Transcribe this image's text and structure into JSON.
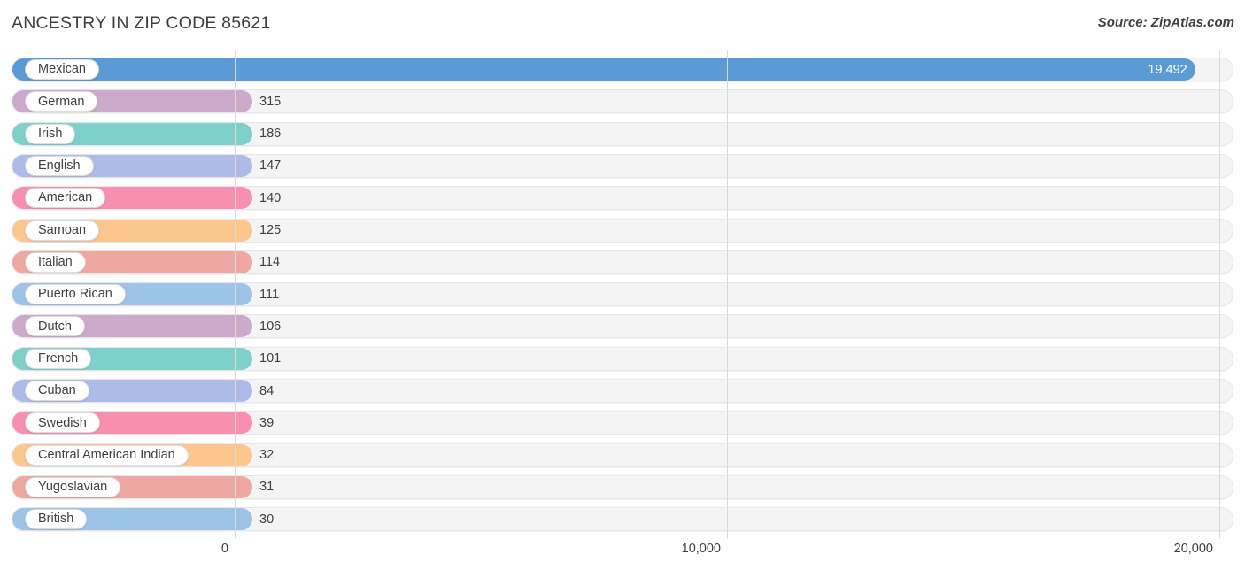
{
  "header": {
    "title": "ANCESTRY IN ZIP CODE 85621",
    "source": "Source: ZipAtlas.com"
  },
  "chart_data": {
    "type": "bar",
    "orientation": "horizontal",
    "title": "ANCESTRY IN ZIP CODE 85621",
    "source": "Source: ZipAtlas.com",
    "xlabel": "",
    "ylabel": "",
    "xlim": [
      0,
      20000
    ],
    "grid": true,
    "legend": null,
    "axis_ticks": [
      "0",
      "10,000",
      "20,000"
    ],
    "axis_tick_values": [
      0,
      10000,
      20000
    ],
    "categories": [
      "Mexican",
      "German",
      "Irish",
      "English",
      "American",
      "Samoan",
      "Italian",
      "Puerto Rican",
      "Dutch",
      "French",
      "Cuban",
      "Swedish",
      "Central American Indian",
      "Yugoslavian",
      "British"
    ],
    "values": [
      19492,
      315,
      186,
      147,
      140,
      125,
      114,
      111,
      106,
      101,
      84,
      39,
      32,
      31,
      30
    ],
    "value_labels": [
      "19,492",
      "315",
      "186",
      "147",
      "140",
      "125",
      "114",
      "111",
      "106",
      "101",
      "84",
      "39",
      "32",
      "31",
      "30"
    ],
    "colors": [
      "#5b9bd5",
      "#cbaacb",
      "#7fcfcb",
      "#aebbe8",
      "#f78fb0",
      "#fbc78d",
      "#eda9a1",
      "#9dc3e6",
      "#cbaacb",
      "#7fcfcb",
      "#aebbe8",
      "#f78fb0",
      "#fbc78d",
      "#eda9a1",
      "#9dc3e6"
    ]
  },
  "rows": [
    {
      "label": "Mexican",
      "value": 19492,
      "value_label": "19,492",
      "color": "#5b9bd5",
      "inside": true
    },
    {
      "label": "German",
      "value": 315,
      "value_label": "315",
      "color": "#cbaacb",
      "inside": false
    },
    {
      "label": "Irish",
      "value": 186,
      "value_label": "186",
      "color": "#7fcfcb",
      "inside": false
    },
    {
      "label": "English",
      "value": 147,
      "value_label": "147",
      "color": "#aebbe8",
      "inside": false
    },
    {
      "label": "American",
      "value": 140,
      "value_label": "140",
      "color": "#f78fb0",
      "inside": false
    },
    {
      "label": "Samoan",
      "value": 125,
      "value_label": "125",
      "color": "#fbc78d",
      "inside": false
    },
    {
      "label": "Italian",
      "value": 114,
      "value_label": "114",
      "color": "#eda9a1",
      "inside": false
    },
    {
      "label": "Puerto Rican",
      "value": 111,
      "value_label": "111",
      "color": "#9dc3e6",
      "inside": false
    },
    {
      "label": "Dutch",
      "value": 106,
      "value_label": "106",
      "color": "#cbaacb",
      "inside": false
    },
    {
      "label": "French",
      "value": 101,
      "value_label": "101",
      "color": "#7fcfcb",
      "inside": false
    },
    {
      "label": "Cuban",
      "value": 84,
      "value_label": "84",
      "color": "#aebbe8",
      "inside": false
    },
    {
      "label": "Swedish",
      "value": 39,
      "value_label": "39",
      "color": "#f78fb0",
      "inside": false
    },
    {
      "label": "Central American Indian",
      "value": 32,
      "value_label": "32",
      "color": "#fbc78d",
      "inside": false
    },
    {
      "label": "Yugoslavian",
      "value": 31,
      "value_label": "31",
      "color": "#eda9a1",
      "inside": false
    },
    {
      "label": "British",
      "value": 30,
      "value_label": "30",
      "color": "#9dc3e6",
      "inside": false
    }
  ],
  "axis": {
    "ticks": [
      {
        "label": "0",
        "value": 0
      },
      {
        "label": "10,000",
        "value": 10000
      },
      {
        "label": "20,000",
        "value": 20000
      }
    ]
  }
}
